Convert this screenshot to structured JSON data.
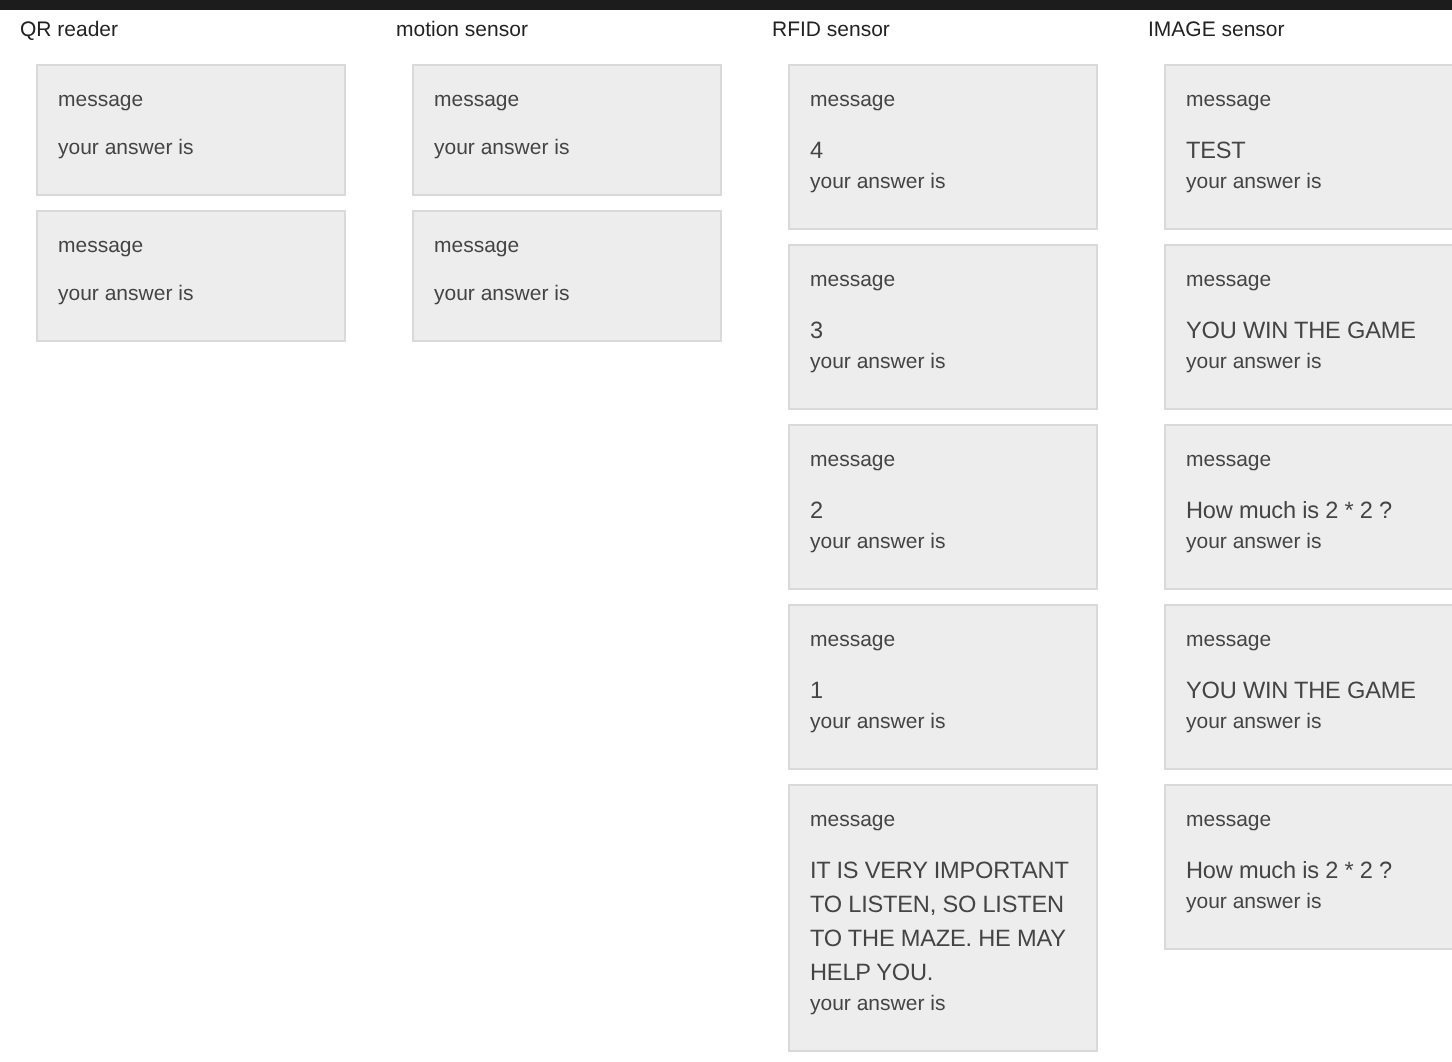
{
  "columns": [
    {
      "title": "QR reader",
      "cards": [
        {
          "label": "message",
          "answer_label": "your answer is"
        },
        {
          "label": "message",
          "answer_label": "your answer is"
        }
      ]
    },
    {
      "title": "motion sensor",
      "cards": [
        {
          "label": "message",
          "answer_label": "your answer is"
        },
        {
          "label": "message",
          "answer_label": "your answer is"
        }
      ]
    },
    {
      "title": "RFID sensor",
      "cards": [
        {
          "label": "message",
          "message": "4",
          "answer_label": "your answer is"
        },
        {
          "label": "message",
          "message": "3",
          "answer_label": "your answer is"
        },
        {
          "label": "message",
          "message": "2",
          "answer_label": "your answer is"
        },
        {
          "label": "message",
          "message": "1",
          "answer_label": "your answer is"
        },
        {
          "label": "message",
          "message": "IT IS VERY IMPORTANT TO LISTEN, SO LISTEN TO THE MAZE. HE MAY HELP YOU.",
          "answer_label": "your answer is"
        }
      ]
    },
    {
      "title": "IMAGE sensor",
      "cards": [
        {
          "label": "message",
          "message": "TEST",
          "answer_label": "your answer is"
        },
        {
          "label": "message",
          "message": "YOU WIN THE GAME",
          "answer_label": "your answer is"
        },
        {
          "label": "message",
          "message": "How much is 2 * 2 ?",
          "answer_label": "your answer is"
        },
        {
          "label": "message",
          "message": "YOU WIN THE GAME",
          "answer_label": "your answer is"
        },
        {
          "label": "message",
          "message": "How much is 2 * 2 ?",
          "answer_label": "your answer is"
        }
      ]
    }
  ]
}
